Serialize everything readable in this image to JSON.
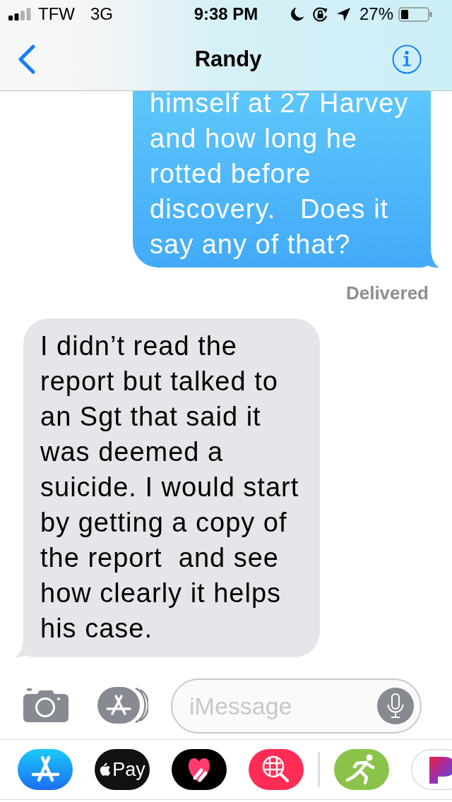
{
  "status_bar": {
    "carrier": "TFW",
    "network": "3G",
    "time": "9:38 PM",
    "battery_percent": "27%"
  },
  "nav": {
    "title": "Randy"
  },
  "messages": [
    {
      "kind": "sent",
      "text": "himself at 27 Harvey\nand how long he\nrotted before\ndiscovery.   Does it\nsay any of that?",
      "status": "Delivered"
    },
    {
      "kind": "received",
      "text": "I didn’t read the\nreport but talked to\nan Sgt that said it\nwas deemed a\nsuicide. I would start\nby getting a copy of\nthe report  and see\nhow clearly it helps\nhis case."
    }
  ],
  "composer": {
    "placeholder": "iMessage"
  },
  "app_drawer": [
    {
      "kind": "store"
    },
    {
      "kind": "pay",
      "label": "Pay"
    },
    {
      "kind": "heart"
    },
    {
      "kind": "web-search"
    },
    {
      "kind": "divider"
    },
    {
      "kind": "runner"
    },
    {
      "kind": "letter-p"
    }
  ]
}
